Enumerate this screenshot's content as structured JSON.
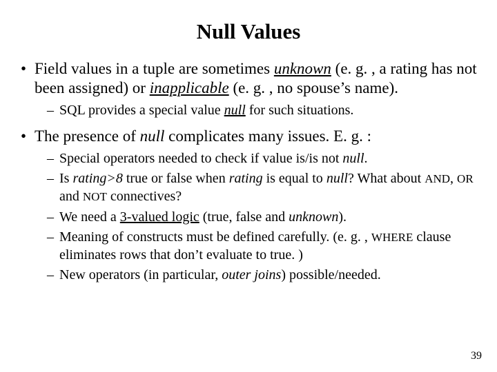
{
  "title": "Null Values",
  "b1": {
    "t1": "Field values in a tuple are sometimes ",
    "unknown": "unknown",
    "t2": " (e. g. , a rating has not been assigned) or ",
    "inapplicable": "inapplicable",
    "t3": " (e. g. , no spouse’s name).",
    "s1": {
      "a": "SQL provides a special value ",
      "null": "null",
      "b": " for such situations."
    }
  },
  "b2": {
    "t1": "The presence of ",
    "null": "null",
    "t2": " complicates many issues. E. g. :",
    "s1": {
      "a": "Special operators needed to check if value is/is not ",
      "null": "null",
      "b": "."
    },
    "s2": {
      "a": "Is ",
      "rating8": "rating>8",
      "b": " true or false when ",
      "rating": "rating",
      "c": " is equal to ",
      "null": "null",
      "d": "?  What about ",
      "and": "AND",
      "sep1": ", ",
      "or": "OR",
      "sep2": " and ",
      "not": "NOT",
      "e": " connectives?"
    },
    "s3": {
      "a": "We need a ",
      "logic": "3-valued logic",
      "b": "  (true, false and ",
      "unknown": "unknown",
      "c": ")."
    },
    "s4": {
      "a": "Meaning of constructs must be defined carefully.  (e. g. , ",
      "where": "WHERE",
      "b": " clause eliminates rows that don’t evaluate to true. )"
    },
    "s5": {
      "a": "New operators (in particular, ",
      "oj": "outer joins",
      "b": ") possible/needed."
    }
  },
  "page": "39"
}
